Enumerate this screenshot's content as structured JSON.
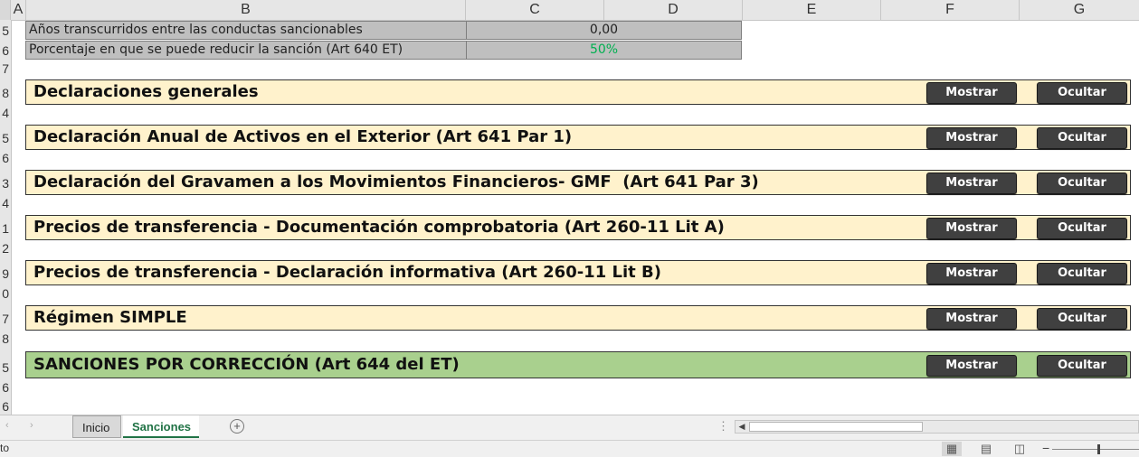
{
  "columns": [
    "A",
    "B",
    "C",
    "D",
    "E",
    "F",
    "G"
  ],
  "row_numbers": [
    "5",
    "6",
    "7",
    "8",
    "4",
    "5",
    "6",
    "3",
    "4",
    "1",
    "2",
    "9",
    "0",
    "7",
    "8",
    "5",
    "6",
    "6"
  ],
  "info": {
    "rows": [
      {
        "label": "Años transcurridos entre las conductas sancionables",
        "value": "0,00",
        "value_color": "#222222"
      },
      {
        "label": "Porcentaje en que se puede reducir la sanción (Art 640 ET)",
        "value": "50%",
        "value_color": "#00b050"
      }
    ]
  },
  "sections": [
    {
      "title": "Declaraciones generales",
      "show": "Mostrar",
      "hide": "Ocultar"
    },
    {
      "title": "Declaración Anual de Activos en el Exterior (Art 641 Par 1)",
      "show": "Mostrar",
      "hide": "Ocultar"
    },
    {
      "title": "Declaración del Gravamen a los Movimientos Financieros- GMF  (Art 641 Par 3)",
      "show": "Mostrar",
      "hide": "Ocultar"
    },
    {
      "title": "Precios de transferencia - Documentación comprobatoria (Art 260-11 Lit A)",
      "show": "Mostrar",
      "hide": "Ocultar"
    },
    {
      "title": "Precios de transferencia - Declaración informativa (Art 260-11 Lit B)",
      "show": "Mostrar",
      "hide": "Ocultar"
    },
    {
      "title": "Régimen SIMPLE",
      "show": "Mostrar",
      "hide": "Ocultar"
    },
    {
      "title": "SANCIONES POR CORRECCIÓN (Art 644 del ET)",
      "show": "Mostrar",
      "hide": "Ocultar"
    }
  ],
  "colors": {
    "section_bg": "#fff2cc",
    "section_highlight_bg": "#a9d08e",
    "button_bg": "#404040",
    "info_bg": "#bfbfbf",
    "active_tab": "#217346"
  },
  "tabs": [
    {
      "label": "Inicio",
      "active": false
    },
    {
      "label": "Sanciones",
      "active": true
    }
  ],
  "tabbar": {
    "add_icon": "plus-circle-icon",
    "add_glyph": "+",
    "more_glyph": "⋮",
    "left_arrow": "‹",
    "right_arrow": "›"
  },
  "status": {
    "text": "to"
  },
  "views": {
    "normal_icon": "normal-view-icon",
    "layout_icon": "page-layout-icon",
    "break_icon": "page-break-icon",
    "zoom_minus": "−"
  }
}
